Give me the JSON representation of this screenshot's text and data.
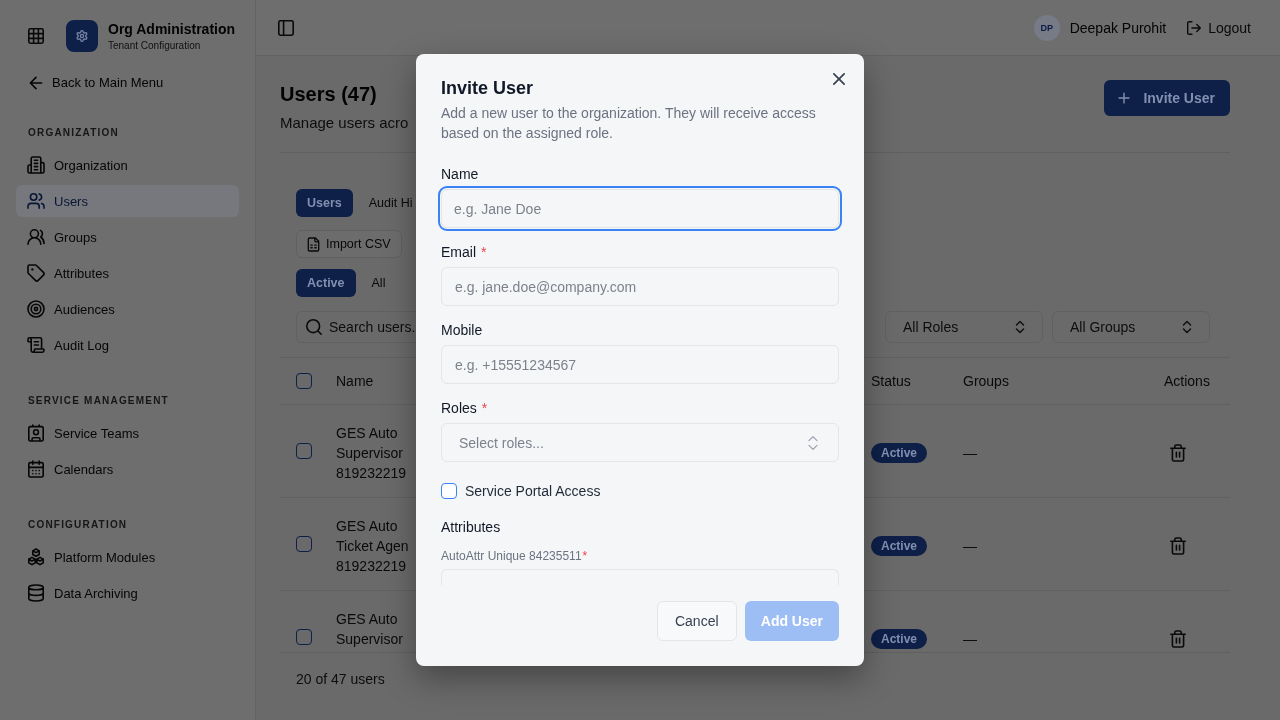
{
  "sidebar": {
    "brand": {
      "title": "Org Administration",
      "subtitle": "Tenant Configuration"
    },
    "back_link": "Back to Main Menu",
    "sections": [
      {
        "heading": "ORGANIZATION",
        "items": [
          {
            "label": "Organization",
            "selected": false
          },
          {
            "label": "Users",
            "selected": true
          },
          {
            "label": "Groups",
            "selected": false
          },
          {
            "label": "Attributes",
            "selected": false
          },
          {
            "label": "Audiences",
            "selected": false
          },
          {
            "label": "Audit Log",
            "selected": false
          }
        ]
      },
      {
        "heading": "SERVICE MANAGEMENT",
        "items": [
          {
            "label": "Service Teams",
            "selected": false
          },
          {
            "label": "Calendars",
            "selected": false
          }
        ]
      },
      {
        "heading": "CONFIGURATION",
        "items": [
          {
            "label": "Platform Modules",
            "selected": false
          },
          {
            "label": "Data Archiving",
            "selected": false
          }
        ]
      }
    ]
  },
  "top_bar": {
    "user": {
      "initials": "DP",
      "name": "Deepak Purohit"
    },
    "logout": "Logout"
  },
  "page": {
    "title": "Users (47)",
    "subtitle": "Manage users acro",
    "invite_button": "Invite User",
    "view_tabs": [
      {
        "label": "Users",
        "selected": true
      },
      {
        "label": "Audit Hi",
        "selected": false
      }
    ],
    "import_button": "Import CSV",
    "status_tabs": [
      {
        "label": "Active",
        "selected": true
      },
      {
        "label": "All",
        "selected": false
      }
    ],
    "search": {
      "placeholder": "Search users."
    },
    "filters": [
      {
        "value": "All Roles"
      },
      {
        "value": "All Groups"
      }
    ],
    "table": {
      "columns": [
        "Name",
        "Status",
        "Groups",
        "Actions"
      ],
      "select_all_checked": false,
      "rows": [
        {
          "checked": false,
          "name": "GES Auto Supervisor 819232219",
          "status": "Active",
          "groups": "—"
        },
        {
          "checked": false,
          "name": "GES Auto Ticket Agen 819232219",
          "status": "Active",
          "groups": "—"
        },
        {
          "checked": false,
          "name": "GES Auto Supervisor",
          "status": "Active",
          "groups": "—"
        }
      ],
      "count": "20 of 47 users"
    }
  },
  "dialog": {
    "title": "Invite User",
    "description": "Add a new user to the organization. They will receive access based on the assigned role.",
    "required_mark": "*",
    "fields": [
      {
        "kind": "text",
        "label": "Name",
        "required": false,
        "placeholder": "e.g. Jane Doe",
        "focused": true
      },
      {
        "kind": "text",
        "label": "Email",
        "required": true,
        "placeholder": "e.g. jane.doe@company.com",
        "focused": false
      },
      {
        "kind": "text",
        "label": "Mobile",
        "required": false,
        "placeholder": "e.g. +15551234567",
        "focused": false
      },
      {
        "kind": "select",
        "label": "Roles",
        "required": true,
        "placeholder": "Select roles...",
        "focused": false
      }
    ],
    "portal_access": {
      "label": "Service Portal Access",
      "checked": false
    },
    "attributes": {
      "heading": "Attributes",
      "items": [
        {
          "label": "AutoAttr Unique 84235511",
          "required": true
        }
      ]
    },
    "buttons": [
      {
        "label": "Cancel",
        "kind": "secondary",
        "disabled": false
      },
      {
        "label": "Add User",
        "kind": "primary",
        "disabled": true
      }
    ]
  }
}
